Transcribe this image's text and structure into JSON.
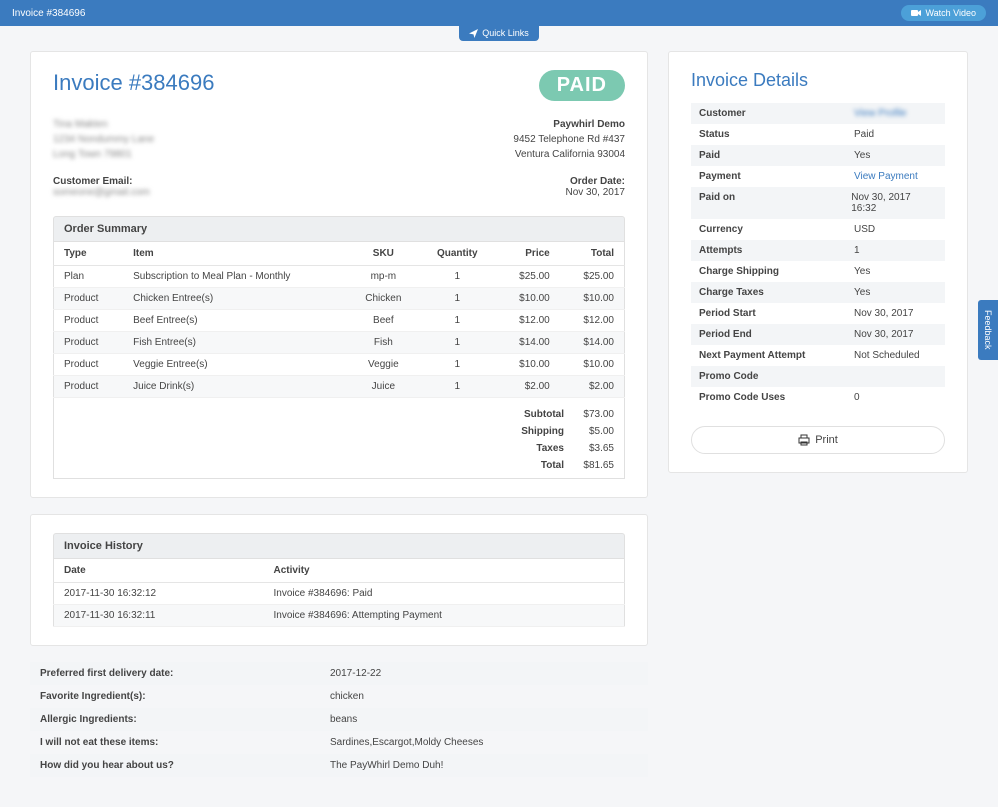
{
  "topbar": {
    "title": "Invoice #384696",
    "watch_video": "Watch Video",
    "quick_links": "Quick Links"
  },
  "invoice": {
    "heading": "Invoice #384696",
    "paid_stamp": "PAID",
    "customer_blur": {
      "line1": "Tina Makten",
      "line2": "1234 Nondummy Lane",
      "line3": "Long Town 79801"
    },
    "company": {
      "name": "Paywhirl Demo",
      "line1": "9452 Telephone Rd #437",
      "line2": "Ventura California 93004"
    },
    "email_label": "Customer Email:",
    "email_blur": "someone@gmail.com",
    "order_date_label": "Order Date:",
    "order_date": "Nov 30, 2017"
  },
  "order_summary": {
    "header": "Order Summary",
    "cols": {
      "type": "Type",
      "item": "Item",
      "sku": "SKU",
      "qty": "Quantity",
      "price": "Price",
      "total": "Total"
    },
    "rows": [
      {
        "type": "Plan",
        "item": "Subscription to Meal Plan - Monthly",
        "sku": "mp-m",
        "qty": "1",
        "price": "$25.00",
        "total": "$25.00"
      },
      {
        "type": "Product",
        "item": "Chicken Entree(s)",
        "sku": "Chicken",
        "qty": "1",
        "price": "$10.00",
        "total": "$10.00"
      },
      {
        "type": "Product",
        "item": "Beef Entree(s)",
        "sku": "Beef",
        "qty": "1",
        "price": "$12.00",
        "total": "$12.00"
      },
      {
        "type": "Product",
        "item": "Fish Entree(s)",
        "sku": "Fish",
        "qty": "1",
        "price": "$14.00",
        "total": "$14.00"
      },
      {
        "type": "Product",
        "item": "Veggie Entree(s)",
        "sku": "Veggie",
        "qty": "1",
        "price": "$10.00",
        "total": "$10.00"
      },
      {
        "type": "Product",
        "item": "Juice Drink(s)",
        "sku": "Juice",
        "qty": "1",
        "price": "$2.00",
        "total": "$2.00"
      }
    ],
    "totals": {
      "subtotal_label": "Subtotal",
      "subtotal": "$73.00",
      "shipping_label": "Shipping",
      "shipping": "$5.00",
      "taxes_label": "Taxes",
      "taxes": "$3.65",
      "total_label": "Total",
      "total": "$81.65"
    }
  },
  "history": {
    "header": "Invoice History",
    "cols": {
      "date": "Date",
      "activity": "Activity"
    },
    "rows": [
      {
        "date": "2017-11-30 16:32:12",
        "activity": "Invoice #384696: Paid"
      },
      {
        "date": "2017-11-30 16:32:11",
        "activity": "Invoice #384696: Attempting Payment"
      }
    ]
  },
  "qa": [
    {
      "q": "Preferred first delivery date:",
      "a": "2017-12-22"
    },
    {
      "q": "Favorite Ingredient(s):",
      "a": "chicken"
    },
    {
      "q": "Allergic Ingredients:",
      "a": "beans"
    },
    {
      "q": "I will not eat these items:",
      "a": "Sardines,Escargot,Moldy Cheeses"
    },
    {
      "q": "How did you hear about us?",
      "a": "The PayWhirl Demo Duh!"
    }
  ],
  "details": {
    "title": "Invoice Details",
    "rows": [
      {
        "k": "Customer",
        "v": "View Profile",
        "link": true,
        "blur": true
      },
      {
        "k": "Status",
        "v": "Paid"
      },
      {
        "k": "Paid",
        "v": "Yes"
      },
      {
        "k": "Payment",
        "v": "View Payment",
        "link": true
      },
      {
        "k": "Paid on",
        "v": "Nov 30, 2017 16:32"
      },
      {
        "k": "Currency",
        "v": "USD"
      },
      {
        "k": "Attempts",
        "v": "1"
      },
      {
        "k": "Charge Shipping",
        "v": "Yes"
      },
      {
        "k": "Charge Taxes",
        "v": "Yes"
      },
      {
        "k": "Period Start",
        "v": "Nov 30, 2017"
      },
      {
        "k": "Period End",
        "v": "Nov 30, 2017"
      },
      {
        "k": "Next Payment Attempt",
        "v": "Not Scheduled"
      },
      {
        "k": "Promo Code",
        "v": ""
      },
      {
        "k": "Promo Code Uses",
        "v": "0"
      }
    ],
    "print": "Print"
  },
  "feedback": "Feedback"
}
